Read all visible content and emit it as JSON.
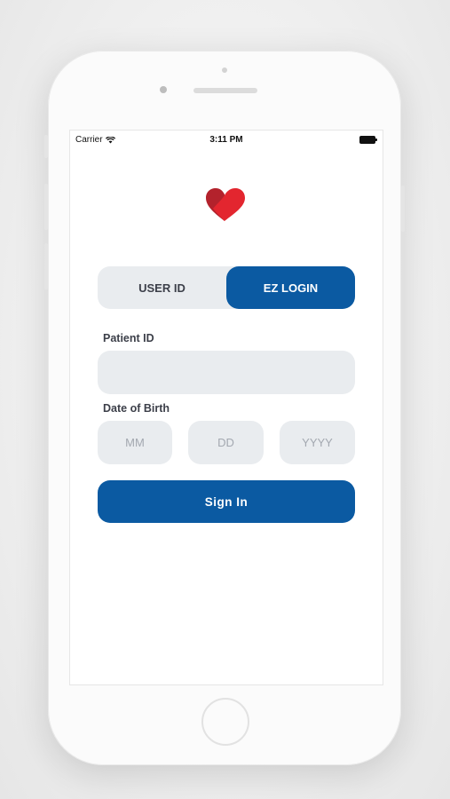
{
  "status_bar": {
    "carrier": "Carrier",
    "time": "3:11 PM"
  },
  "brand": {
    "logo_icon": "heart-icon",
    "logo_colors": [
      "#b3222c",
      "#e3262f"
    ]
  },
  "login_tabs": [
    {
      "label": "USER ID",
      "active": false
    },
    {
      "label": "EZ LOGIN",
      "active": true
    }
  ],
  "form": {
    "patient_id_label": "Patient ID",
    "patient_id_value": "",
    "patient_id_placeholder": "",
    "dob_label": "Date of Birth",
    "month_placeholder": "MM",
    "day_placeholder": "DD",
    "year_placeholder": "YYYY",
    "sign_in_label": "Sign In"
  },
  "colors": {
    "accent": "#0b5aa2",
    "field_bg": "#e9ecef",
    "brand_red": "#e3262f"
  }
}
